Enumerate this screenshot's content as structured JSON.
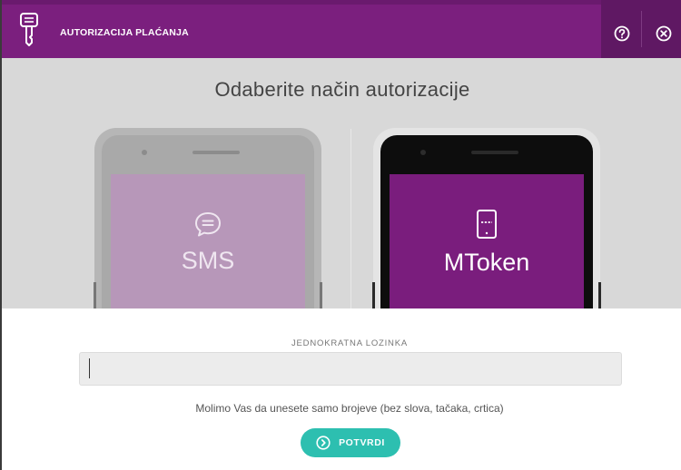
{
  "header": {
    "title": "AUTORIZACIJA PLAĆANJA",
    "logo_icon": "key-icon",
    "help_icon": "help-circle-icon",
    "close_icon": "close-circle-icon",
    "colors": {
      "bar": "#7b1f7e",
      "right_block": "#5f1863"
    }
  },
  "method_select": {
    "title": "Odaberite način autorizacije",
    "options": [
      {
        "label": "SMS",
        "icon": "chat-bubble-icon",
        "state": "inactive"
      },
      {
        "label": "MToken",
        "icon": "mobile-token-icon",
        "state": "selected"
      }
    ]
  },
  "form": {
    "field_label": "JEDNOKRATNA LOZINKA",
    "otp_value": "",
    "otp_placeholder": "",
    "hint": "Molimo Vas da unesete samo brojeve (bez slova, tačaka, crtica)",
    "confirm_label": "POTVRDI",
    "confirm_icon": "chevron-right-circle-icon",
    "accent": "#2dbfb0"
  }
}
